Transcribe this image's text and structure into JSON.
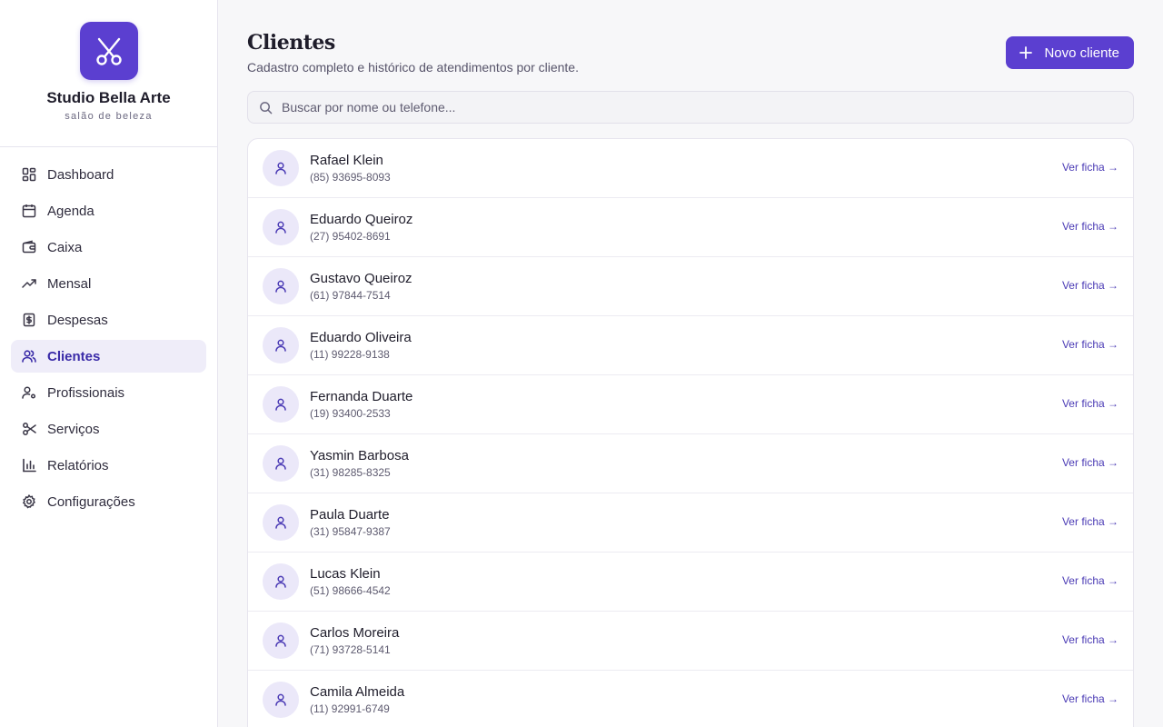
{
  "brand": {
    "name": "Studio Bella Arte",
    "subtitle": "salão de beleza",
    "accent": "#5b3fd0"
  },
  "sidebar": {
    "items": [
      {
        "label": "Dashboard",
        "icon": "dashboard-icon"
      },
      {
        "label": "Agenda",
        "icon": "calendar-icon"
      },
      {
        "label": "Caixa",
        "icon": "wallet-icon"
      },
      {
        "label": "Mensal",
        "icon": "trending-up-icon"
      },
      {
        "label": "Despesas",
        "icon": "receipt-dollar-icon"
      },
      {
        "label": "Clientes",
        "icon": "users-icon",
        "active": true
      },
      {
        "label": "Profissionais",
        "icon": "user-cog-icon"
      },
      {
        "label": "Serviços",
        "icon": "scissors-icon"
      },
      {
        "label": "Relatórios",
        "icon": "bar-chart-icon"
      },
      {
        "label": "Configurações",
        "icon": "gear-icon"
      }
    ]
  },
  "header": {
    "title": "Clientes",
    "subtitle": "Cadastro completo e histórico de atendimentos por cliente.",
    "new_button": "Novo cliente"
  },
  "search": {
    "placeholder": "Buscar por nome ou telefone...",
    "value": ""
  },
  "clients": [
    {
      "name": "Rafael Klein",
      "phone": "(85) 93695-8093",
      "action": "Ver ficha →"
    },
    {
      "name": "Eduardo Queiroz",
      "phone": "(27) 95402-8691",
      "action": "Ver ficha →"
    },
    {
      "name": "Gustavo Queiroz",
      "phone": "(61) 97844-7514",
      "action": "Ver ficha →"
    },
    {
      "name": "Eduardo Oliveira",
      "phone": "(11) 99228-9138",
      "action": "Ver ficha →"
    },
    {
      "name": "Fernanda Duarte",
      "phone": "(19) 93400-2533",
      "action": "Ver ficha →"
    },
    {
      "name": "Yasmin Barbosa",
      "phone": "(31) 98285-8325",
      "action": "Ver ficha →"
    },
    {
      "name": "Paula Duarte",
      "phone": "(31) 95847-9387",
      "action": "Ver ficha →"
    },
    {
      "name": "Lucas Klein",
      "phone": "(51) 98666-4542",
      "action": "Ver ficha →"
    },
    {
      "name": "Carlos Moreira",
      "phone": "(71) 93728-5141",
      "action": "Ver ficha →"
    },
    {
      "name": "Camila Almeida",
      "phone": "(11) 92991-6749",
      "action": "Ver ficha →"
    }
  ]
}
